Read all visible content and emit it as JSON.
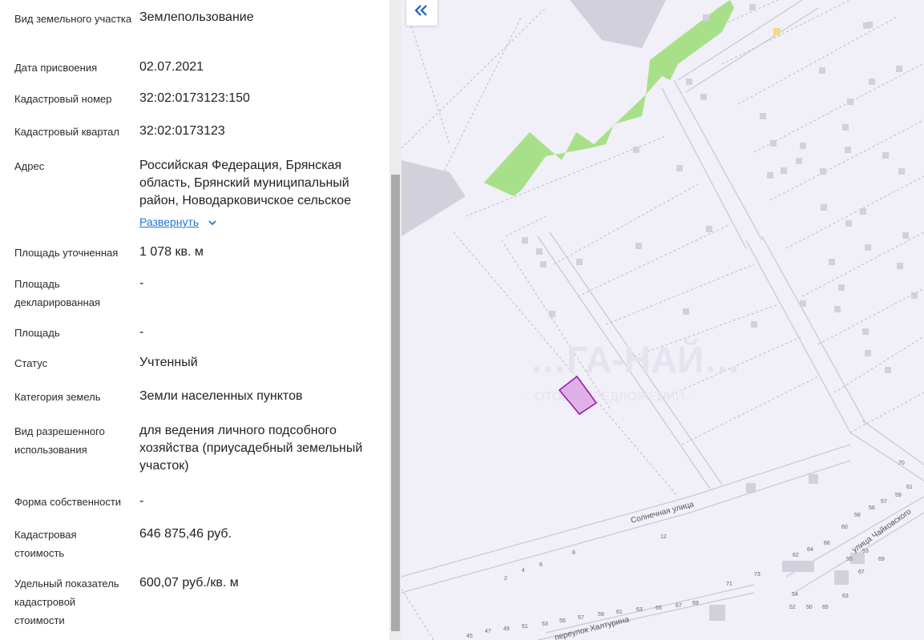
{
  "colors": {
    "map_background": "#f1eff7",
    "park": "#a8e08a",
    "road_edge": "#c9c6d6",
    "building": "#d2d0da",
    "parcel_fill": "#dda6e6",
    "parcel_stroke": "#9b1ba8",
    "link": "#1f77d0"
  },
  "fields": [
    {
      "label": "Вид земельного участка",
      "value": "Землепользование"
    },
    {
      "label": "Дата присвоения",
      "value": "02.07.2021"
    },
    {
      "label": "Кадастровый номер",
      "value": "32:02:0173123:150"
    },
    {
      "label": "Кадастровый квартал",
      "value": "32:02:0173123"
    },
    {
      "label": "Адрес",
      "value": "Российская Федерация, Брянская область, Брянский муниципальный район, Новодарковичское сельское"
    },
    {
      "label": "Площадь уточненная",
      "value": "1 078 кв. м"
    },
    {
      "label": "Площадь декларированная",
      "value": "-"
    },
    {
      "label": "Площадь",
      "value": "-"
    },
    {
      "label": "Статус",
      "value": "Учтенный"
    },
    {
      "label": "Категория земель",
      "value": "Земли населенных пунктов"
    },
    {
      "label": "Вид разрешенного использования",
      "value": "для ведения личного подсобного хозяйства (приусадебный земельный участок)"
    },
    {
      "label": "Форма собственности",
      "value": "-"
    },
    {
      "label": "Кадастровая стоимость",
      "value": "646 875,46 руб."
    },
    {
      "label": "Удельный показатель кадастровой стоимости",
      "value": "600,07 руб./кв. м"
    }
  ],
  "address_expand_label": "Развернуть",
  "map": {
    "collapse_icon": "«",
    "watermark": "…ГА-НАЙ…",
    "watermark_sub": "…ОТОВО ПРЕДЛОЖЕНИЙ…",
    "streets": [
      "Солнечная улица",
      "улица Чайковского",
      "переулок Халтурина"
    ],
    "house_numbers": [
      "2",
      "4",
      "6",
      "8",
      "12",
      "45",
      "47",
      "49",
      "51",
      "53",
      "55",
      "57",
      "59",
      "61",
      "63",
      "65",
      "67",
      "69",
      "71",
      "73",
      "54",
      "52",
      "50",
      "65",
      "63",
      "67",
      "69",
      "62",
      "64",
      "66",
      "60",
      "58",
      "56",
      "57",
      "59",
      "61",
      "55",
      "53",
      "70"
    ]
  }
}
